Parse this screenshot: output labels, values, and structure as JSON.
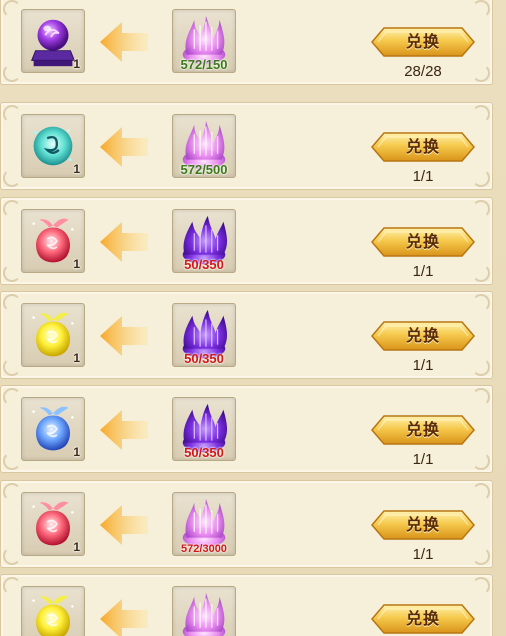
{
  "exchange_list": {
    "rows": [
      {
        "target_item": "purple-orb-on-stand",
        "target_qty": "1",
        "source_item": "pink-flame-essence",
        "have_text": "572/150",
        "have_status": "ok",
        "button_label": "兑换",
        "count_text": "28/28"
      },
      {
        "target_item": "cyan-rune-orb",
        "target_qty": "1",
        "source_item": "pink-flame-essence",
        "have_text": "572/500",
        "have_status": "ok",
        "button_label": "兑换",
        "count_text": "1/1"
      },
      {
        "target_item": "red-spirit-fruit",
        "target_qty": "1",
        "source_item": "violet-flame-essence",
        "have_text": "50/350",
        "have_status": "lack",
        "button_label": "兑换",
        "count_text": "1/1"
      },
      {
        "target_item": "yellow-spirit-fruit",
        "target_qty": "1",
        "source_item": "violet-flame-essence",
        "have_text": "50/350",
        "have_status": "lack",
        "button_label": "兑换",
        "count_text": "1/1"
      },
      {
        "target_item": "blue-spirit-fruit",
        "target_qty": "1",
        "source_item": "violet-flame-essence",
        "have_text": "50/350",
        "have_status": "lack",
        "button_label": "兑换",
        "count_text": "1/1"
      },
      {
        "target_item": "red-spirit-fruit",
        "target_qty": "1",
        "source_item": "pink-flame-essence",
        "have_text": "572/3000",
        "have_status": "lack",
        "button_label": "兑换",
        "count_text": "1/1"
      },
      {
        "target_item": "yellow-spirit-fruit",
        "target_qty": "",
        "source_item": "pink-flame-essence",
        "have_text": "",
        "have_status": "ok",
        "button_label": "兑换",
        "count_text": ""
      }
    ]
  },
  "colors": {
    "have_ok": "#3a7a19",
    "have_lack": "#d01818",
    "button_gold": "#f3c24a",
    "arrow_gold": "#f7c24c"
  }
}
